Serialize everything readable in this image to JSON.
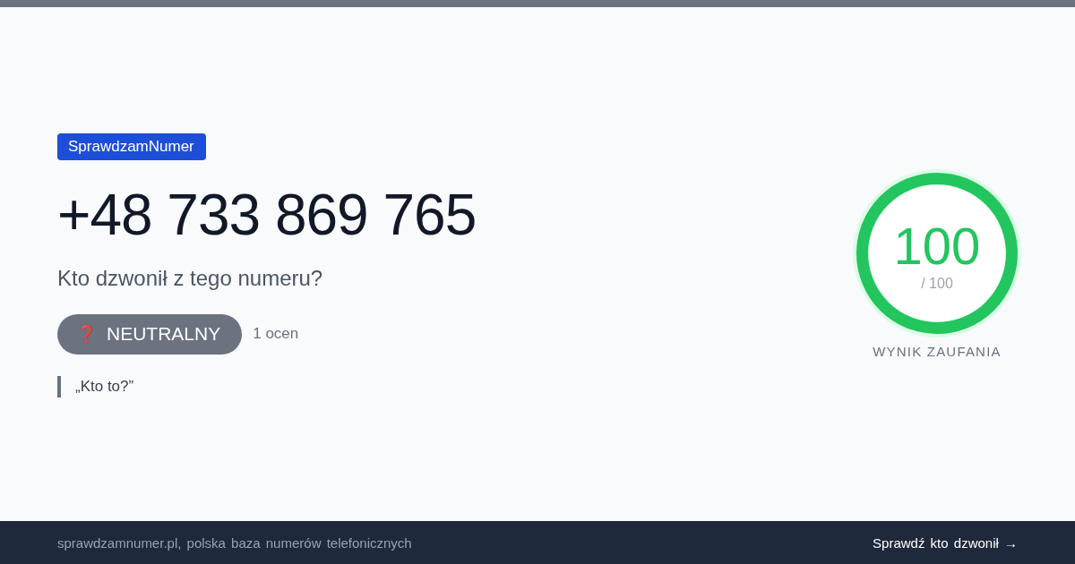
{
  "brand_tag": "SprawdzamNumer",
  "phone_number": "+48 733 869 765",
  "subtitle": "Kto dzwonił z tego numeru?",
  "verdict": {
    "kind": "neutral",
    "icon": "❓",
    "label": "NEUTRALNY"
  },
  "rating_count": "1 ocen",
  "quote": "„Kto to?”",
  "score": {
    "value": "100",
    "max": "/ 100",
    "level": 1.0,
    "label": "WYNIK ZAUFANIA"
  },
  "footer": {
    "text": "sprawdzamnumer.pl, polska baza numerów telefonicznych",
    "link": "Sprawdź kto dzwonił →"
  }
}
